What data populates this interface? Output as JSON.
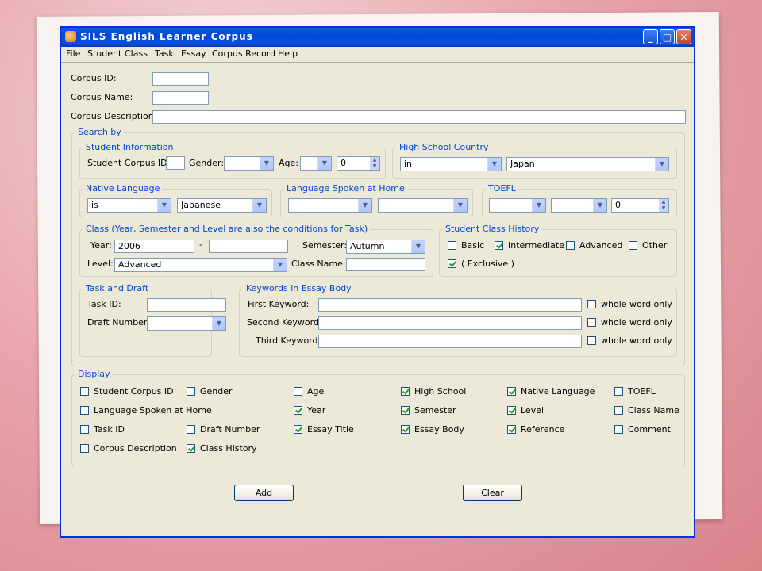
{
  "window": {
    "title": "SILS English Learner Corpus",
    "min": "_",
    "max": "□",
    "close": "✕"
  },
  "menu": [
    "File",
    "Student",
    "Class",
    "Task",
    "Essay",
    "Corpus Record",
    "Help"
  ],
  "corpus": {
    "id_label": "Corpus ID:",
    "name_label": "Corpus Name:",
    "desc_label": "Corpus Description:",
    "id_value": "",
    "name_value": "",
    "desc_value": ""
  },
  "search": {
    "title": "Search by",
    "student_info": {
      "title": "Student Information",
      "corpus_id_label": "Student Corpus ID:",
      "corpus_id_value": "",
      "gender_label": "Gender:",
      "gender_value": "",
      "age_label": "Age:",
      "age_op": "",
      "age_value": "0"
    },
    "hs_country": {
      "title": "High School Country",
      "op": "in",
      "value": "Japan"
    },
    "native_language": {
      "title": "Native Language",
      "op": "is",
      "value": "Japanese"
    },
    "home_language": {
      "title": "Language Spoken at Home",
      "op": "",
      "value": ""
    },
    "toefl": {
      "title": "TOEFL",
      "a": "",
      "b": "",
      "value": "0"
    },
    "class": {
      "title": "Class (Year, Semester and Level are also the conditions for Task)",
      "year_label": "Year:",
      "year_from": "2006",
      "dash": "-",
      "year_to": "",
      "semester_label": "Semester:",
      "semester_value": "Autumn",
      "level_label": "Level:",
      "level_value": "Advanced",
      "class_name_label": "Class Name:",
      "class_name_value": ""
    },
    "class_history": {
      "title": "Student Class History",
      "options": [
        {
          "label": "Basic",
          "checked": false
        },
        {
          "label": "Intermediate",
          "checked": true
        },
        {
          "label": "Advanced",
          "checked": false
        },
        {
          "label": "Other",
          "checked": false
        }
      ],
      "exclusive": {
        "label": "( Exclusive )",
        "checked": true
      }
    },
    "task": {
      "title": "Task and Draft",
      "task_label": "Task ID:",
      "task_value": "",
      "draft_label": "Draft Number:",
      "draft_value": ""
    },
    "keywords": {
      "title": "Keywords in Essay Body",
      "rows": [
        {
          "label": "First Keyword:",
          "value": "",
          "whole": "whole word only",
          "checked": false
        },
        {
          "label": "Second Keyword:",
          "value": "",
          "whole": "whole word only",
          "checked": false
        },
        {
          "label": "Third Keyword:",
          "value": "",
          "whole": "whole word only",
          "checked": false
        }
      ]
    }
  },
  "display": {
    "title": "Display",
    "items": [
      {
        "label": "Student Corpus ID",
        "checked": false
      },
      {
        "label": "Gender",
        "checked": false
      },
      {
        "label": "Age",
        "checked": false
      },
      {
        "label": "High School",
        "checked": true
      },
      {
        "label": "Native Language",
        "checked": true
      },
      {
        "label": "TOEFL",
        "checked": false
      },
      {
        "label": "Language Spoken at Home",
        "checked": false
      },
      {
        "label": "Year",
        "checked": true
      },
      {
        "label": "Semester",
        "checked": true
      },
      {
        "label": "Level",
        "checked": true
      },
      {
        "label": "Class Name",
        "checked": false
      },
      {
        "label": "Task ID",
        "checked": false
      },
      {
        "label": "Draft Number",
        "checked": false
      },
      {
        "label": "Essay Title",
        "checked": true
      },
      {
        "label": "Essay Body",
        "checked": true
      },
      {
        "label": "Reference",
        "checked": true
      },
      {
        "label": "Comment",
        "checked": false
      },
      {
        "label": "Corpus Description",
        "checked": false
      },
      {
        "label": "Class History",
        "checked": true
      }
    ]
  },
  "buttons": {
    "add": "Add",
    "clear": "Clear"
  }
}
